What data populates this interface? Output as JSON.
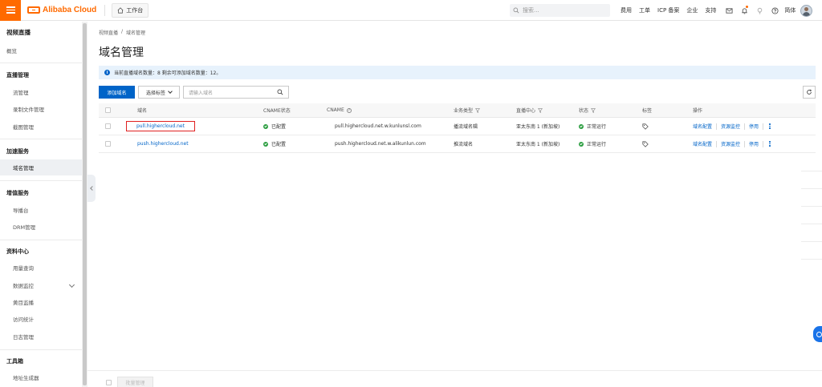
{
  "topbar": {
    "brand": "Alibaba Cloud",
    "workbench": "工作台",
    "search_placeholder": "搜索...",
    "links": [
      "费用",
      "工单",
      "ICP 备案",
      "企业",
      "支持"
    ],
    "lang": "简体"
  },
  "sidebar": {
    "title": "视频直播",
    "overview": "概览",
    "sections": [
      {
        "label": "直播管理",
        "items": [
          "流管理",
          "录制文件管理",
          "截图管理"
        ]
      },
      {
        "label": "加速服务",
        "items": [
          "域名管理"
        ]
      },
      {
        "label": "增值服务",
        "items": [
          "导播台",
          "DRM管理"
        ]
      },
      {
        "label": "资料中心",
        "items": [
          "用量查询",
          "数据监控",
          "黄目监播",
          "访问统计",
          "日志管理"
        ]
      },
      {
        "label": "工具箱",
        "items": [
          "地址生成器"
        ]
      }
    ]
  },
  "main": {
    "breadcrumb": [
      "视频直播",
      "/",
      "域名管理"
    ],
    "title": "域名管理",
    "info": "当前直播域名数量：8 剩余可添加域名数量：12。",
    "add_button": "添加域名",
    "select_tag": "选择标签",
    "search_placeholder": "请输入域名",
    "columns": {
      "domain": "域名",
      "cname_status": "CNAME状态",
      "cname": "CNAME",
      "biz_type": "业务类型",
      "center": "直播中心",
      "status": "状态",
      "tags": "标签",
      "ops": "操作"
    },
    "rows": [
      {
        "domain": "pull.highercloud.net",
        "cname_status": "已配置",
        "cname": "pull.highercloud.net.w.kunlunsl.com",
        "biz_type": "播流域名辑",
        "center": "亚太东南 1 (新加坡)",
        "status": "正常运行"
      },
      {
        "domain": "push.highercloud.net",
        "cname_status": "已配置",
        "cname": "push.highercloud.net.w.alikunlun.com",
        "biz_type": "推流域名",
        "center": "亚太东南 1 (新加坡)",
        "status": "正常运行"
      }
    ],
    "ops": {
      "config": "域名配置",
      "monitor": "资源监控",
      "disable": "停用"
    },
    "batch_button": "批量管理"
  }
}
